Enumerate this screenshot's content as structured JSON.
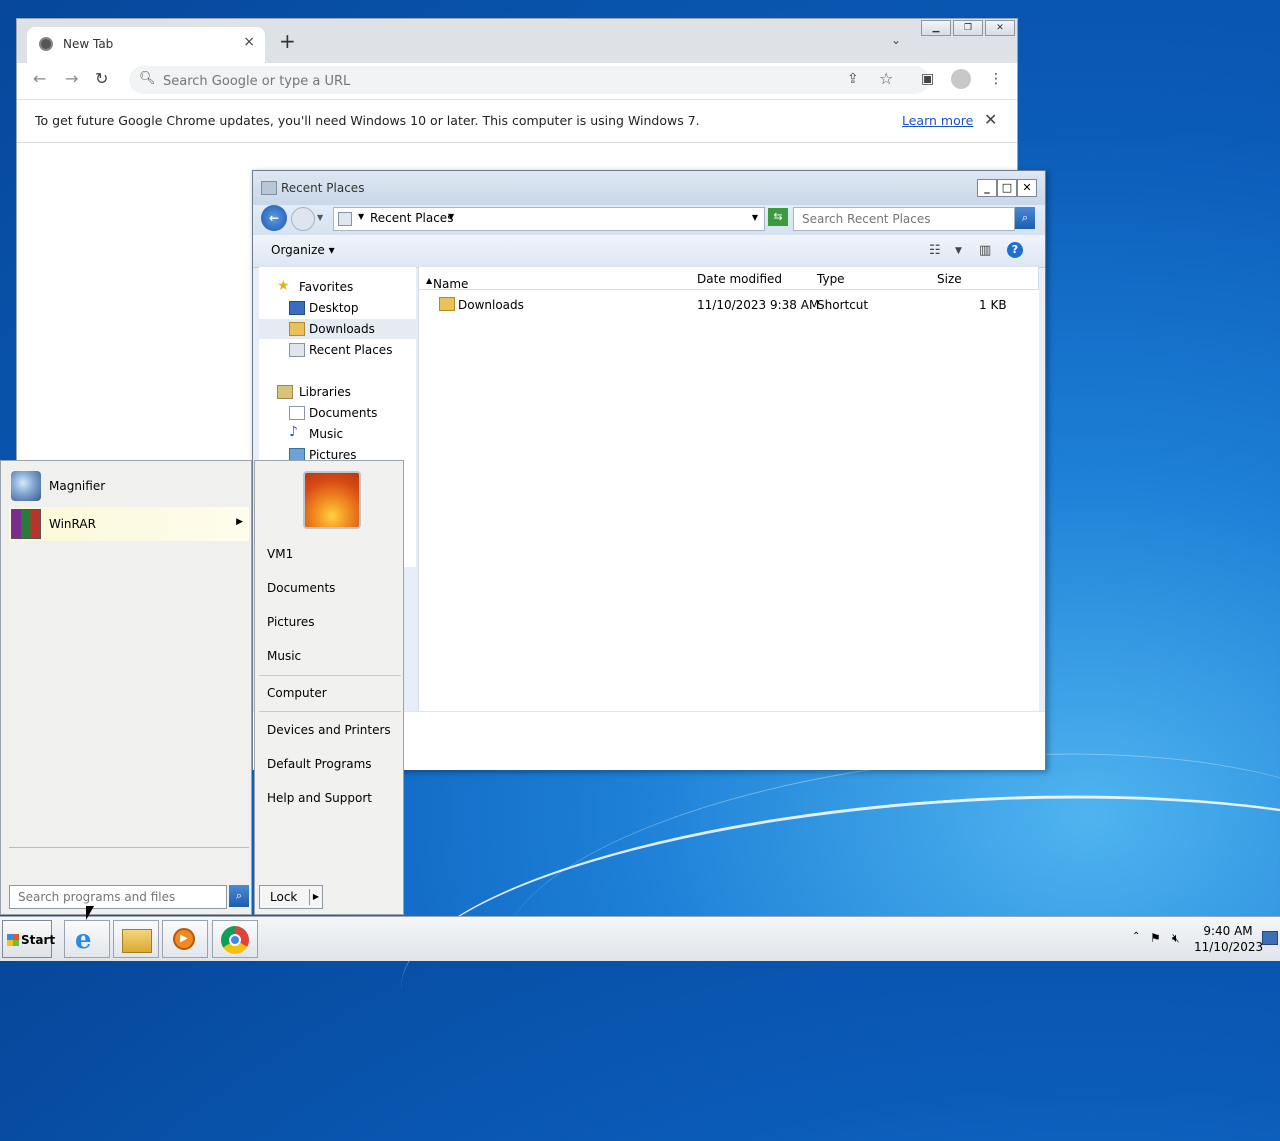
{
  "chrome": {
    "tab_title": "New Tab",
    "tab_close": "×",
    "new_tab": "+",
    "tab_search": "⌄",
    "omnibox_placeholder": "Search Google or type a URL",
    "info_message": "To get future Google Chrome updates, you'll need Windows 10 or later. This computer is using Windows 7.",
    "learn_more": "Learn more",
    "info_close": "✕"
  },
  "explorer": {
    "title": "Recent Places",
    "address": "Recent Places",
    "search_placeholder": "Search Recent Places",
    "organize": "Organize",
    "nav": {
      "favorites": "Favorites",
      "desktop": "Desktop",
      "downloads": "Downloads",
      "recent_places": "Recent Places",
      "libraries": "Libraries",
      "documents": "Documents",
      "music": "Music",
      "pictures": "Pictures"
    },
    "columns": {
      "name": "Name",
      "date": "Date modified",
      "type": "Type",
      "size": "Size"
    },
    "files": [
      {
        "name": "Downloads",
        "date": "11/10/2023 9:38 AM",
        "type": "Shortcut",
        "size": "1 KB"
      }
    ]
  },
  "start_menu": {
    "programs": [
      {
        "label": "Magnifier"
      },
      {
        "label": "WinRAR"
      }
    ],
    "search_placeholder": "Search programs and files",
    "right": {
      "user": "VM1",
      "documents": "Documents",
      "pictures": "Pictures",
      "music": "Music",
      "computer": "Computer",
      "devices": "Devices and Printers",
      "defaults": "Default Programs",
      "help": "Help and Support"
    },
    "lock": "Lock"
  },
  "taskbar": {
    "start_label": "Start",
    "time": "9:40 AM",
    "date": "11/10/2023"
  },
  "colors": {
    "accent": "#1e6fd0",
    "desktop": "#0a5bb8"
  }
}
